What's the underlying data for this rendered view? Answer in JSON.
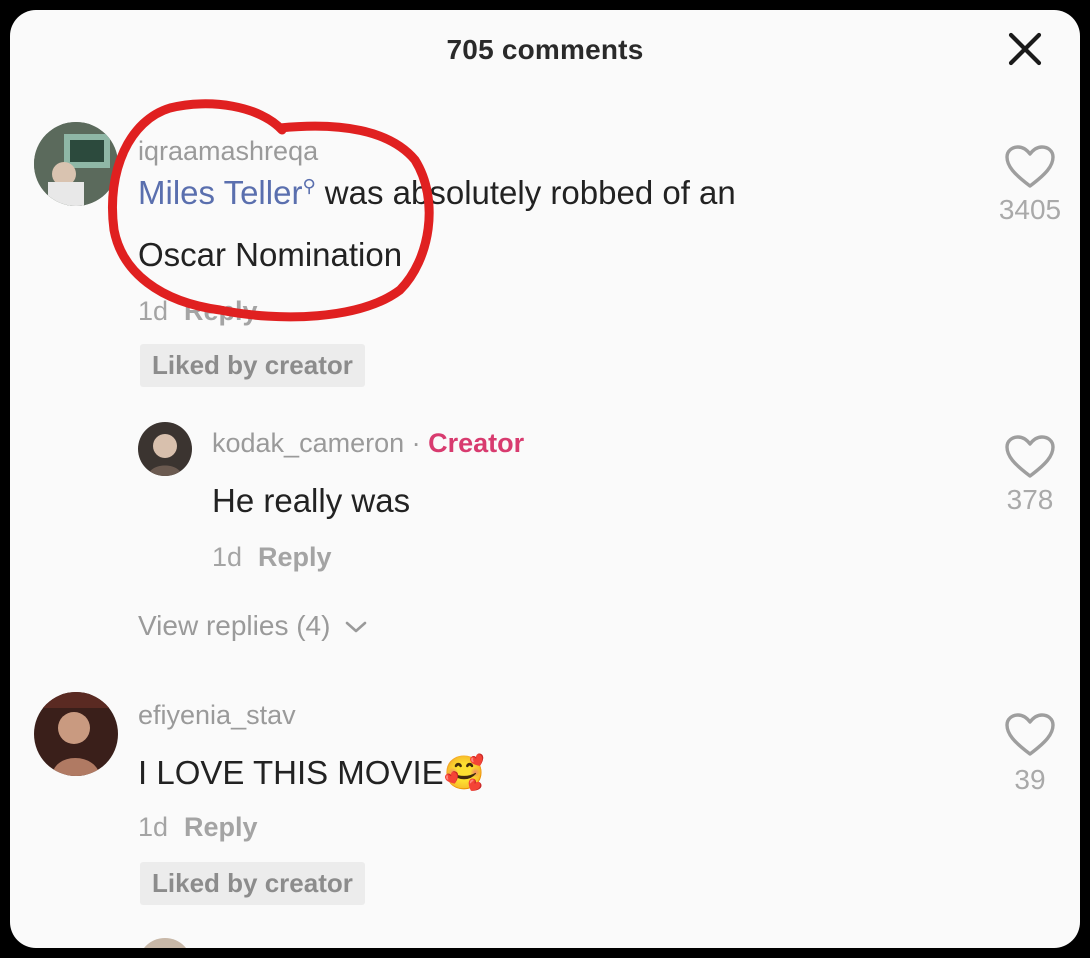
{
  "header": {
    "title": "705 comments"
  },
  "comments": [
    {
      "username": "iqraamashreqa",
      "mention": "Miles Teller",
      "text_line1": " was absolutely robbed of an",
      "text_line2": "Oscar Nomination",
      "time": "1d",
      "reply_label": "Reply",
      "badge": "Liked by creator",
      "likes": "3405"
    },
    {
      "username": "kodak_cameron",
      "separator": " · ",
      "creator_label": "Creator",
      "text": "He really was",
      "time": "1d",
      "reply_label": "Reply",
      "likes": "378"
    },
    {
      "username": "efiyenia_stav",
      "text": "I LOVE THIS MOVIE",
      "emoji": "🥰",
      "time": "1d",
      "reply_label": "Reply",
      "badge": "Liked by creator",
      "likes": "39"
    }
  ],
  "view_replies": {
    "label": "View replies (4)"
  },
  "icons": {
    "close": "close-icon",
    "like": "heart-outline-icon",
    "expand": "chevron-down-icon"
  },
  "colors": {
    "mention": "#5a6fae",
    "creator": "#d83b6f",
    "annotation": "#e02020"
  }
}
